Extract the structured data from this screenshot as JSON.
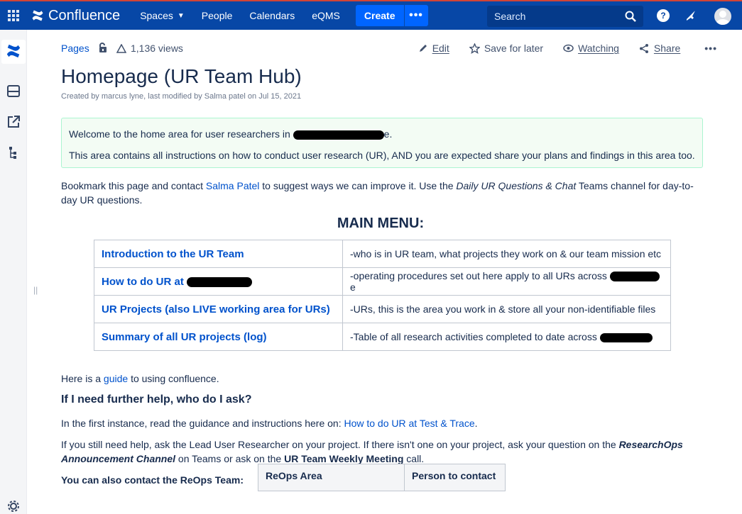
{
  "nav": {
    "brand": "Confluence",
    "items": [
      {
        "label": "Spaces",
        "caret": true
      },
      {
        "label": "People"
      },
      {
        "label": "Calendars"
      },
      {
        "label": "eQMS"
      }
    ],
    "create_label": "Create",
    "more_label": "•••",
    "search_placeholder": "Search",
    "help_label": "?"
  },
  "page": {
    "breadcrumb": "Pages",
    "views": "1,136 views",
    "actions": {
      "edit": "Edit",
      "save": "Save for later",
      "watch": "Watching",
      "share": "Share",
      "more": "•••"
    },
    "title": "Homepage (UR Team Hub)",
    "byline": "Created by marcus lyne, last modified by Salma patel on Jul 15, 2021"
  },
  "info": {
    "line1": "Welcome to the home area for user researchers in",
    "line1_end": "e.",
    "line2": "This area contains all instructions on how to conduct user research (UR), AND you are expected share your plans and findings in this area too."
  },
  "bookmark": {
    "pre": "Bookmark this page and contact ",
    "contact": "Salma Patel",
    "mid": " to suggest ways we can improve it. Use the ",
    "channel": "Daily UR Questions & Chat",
    "post": " Teams channel for day-to-day UR questions."
  },
  "main_menu": {
    "title": "MAIN MENU:",
    "rows": [
      {
        "link": "Introduction to the UR Team",
        "desc": "-who is in UR team, what projects they work on & our team mission etc"
      },
      {
        "link": "How to do UR at",
        "desc": "-operating procedures set out here apply to all URs across",
        "desc_end": "e"
      },
      {
        "link": "UR Projects (also LIVE working area for URs)",
        "desc": "-URs, this is the area you work in & store all your non-identifiable files"
      },
      {
        "link": "Summary of all UR projects (log)",
        "desc": "-Table of all research activities completed to date across"
      }
    ]
  },
  "guide": {
    "pre": "Here is a ",
    "link": "guide",
    "post": " to using confluence."
  },
  "help": {
    "heading": "If I need further help, who do I ask?",
    "p1_pre": "In the first instance, read the guidance and instructions here on: ",
    "p1_link": "How to do UR at Test & Trace",
    "p1_post": ".",
    "p2_pre": "If you still need help, ask the Lead User Researcher on your project. If there isn't one on your project, ask your question on the ",
    "p2_em": "ResearchOps Announcement Channel",
    "p2_mid": " on Teams or ask on the ",
    "p2_strong": "UR Team Weekly Meeting",
    "p2_post": " call.",
    "contact_heading": "You can also contact the ReOps Team:"
  },
  "contact_table": {
    "headers": [
      "ReOps Area",
      "Person to contact"
    ]
  },
  "colors": {
    "nav_bg": "#0747a6",
    "nav_border": "#d04437",
    "create_btn": "#0065ff",
    "link": "#0052cc",
    "info_bg": "#f3fcf4",
    "info_border": "#abf5d1"
  }
}
